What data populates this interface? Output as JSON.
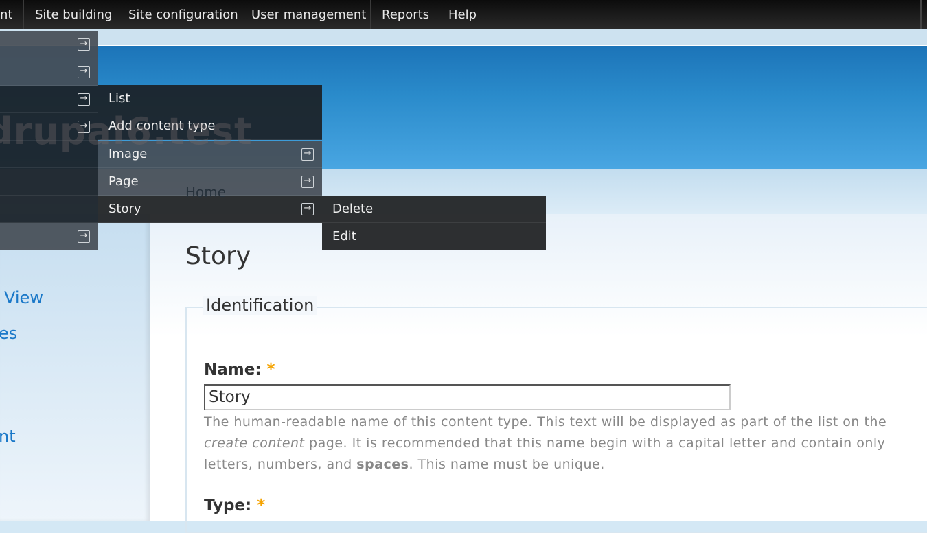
{
  "topnav": [
    "nt",
    "Site building",
    "Site configuration",
    "User management",
    "Reports",
    "Help"
  ],
  "watermark": "drupal6.test",
  "breadcrumb": "Home",
  "sidebar_links": [
    "View",
    "es",
    "nt"
  ],
  "submenu": [
    "List",
    "Add content type",
    "Image",
    "Page",
    "Story"
  ],
  "story_menu": [
    "Delete",
    "Edit"
  ],
  "page_title": "Story",
  "fieldset_legend": "Identification",
  "name_label": "Name:",
  "name_value": "Story",
  "required_mark": "*",
  "desc": {
    "line1": "The human-readable name of this content type. This text will be displayed as part of the list on the",
    "line2_em": "create content",
    "line2_rest": " page. It is recommended that this name begin with a capital letter and contain only",
    "line3_a": "letters, numbers, and ",
    "line3_b": "spaces",
    "line3_c": ". This name must be unique."
  },
  "type_label": "Type:"
}
